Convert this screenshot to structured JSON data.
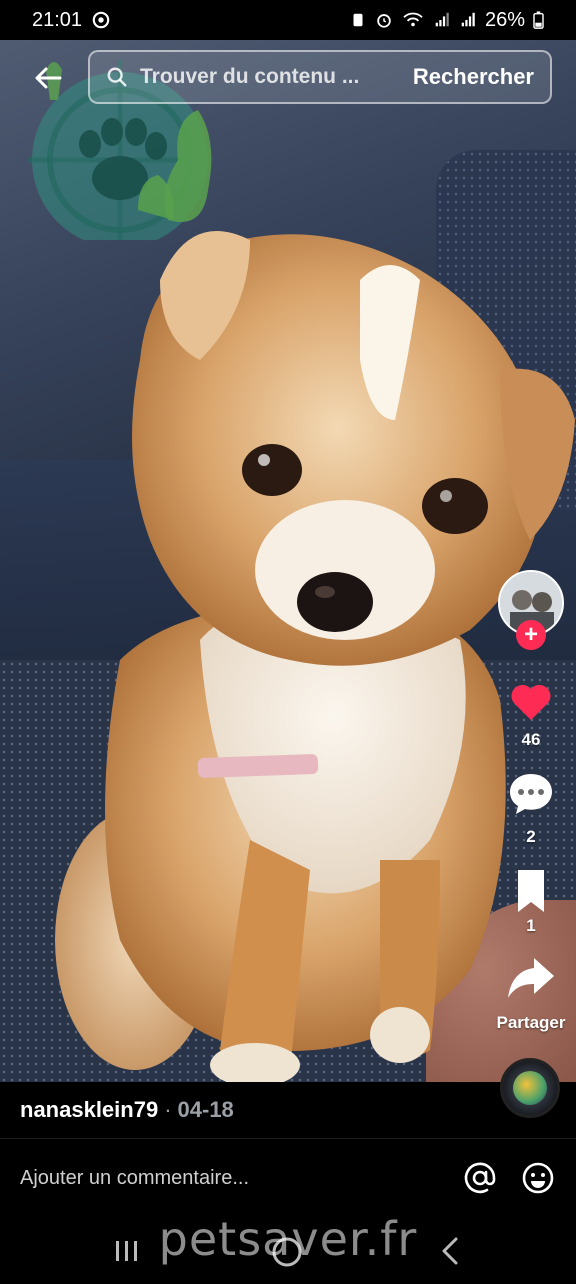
{
  "status_bar": {
    "time": "21:01",
    "battery": "26%"
  },
  "search": {
    "placeholder": "Trouver du contenu ...",
    "button_label": "Rechercher"
  },
  "actions": {
    "likes": "46",
    "comments": "2",
    "saves": "1",
    "share_label": "Partager"
  },
  "post": {
    "author": "nanasklein79",
    "separator": "·",
    "date": "04-18"
  },
  "comment_box": {
    "placeholder": "Ajouter un commentaire..."
  },
  "watermark": {
    "site": "petsaver.fr"
  },
  "colors": {
    "like": "#fe2c55",
    "follow": "#fe2c55",
    "logo": "#2f9a86"
  },
  "icons": [
    "back-arrow-icon",
    "search-icon",
    "heart-icon",
    "comment-icon",
    "bookmark-icon",
    "share-icon",
    "at-icon",
    "emoji-icon",
    "recent-apps-icon",
    "home-icon",
    "back-nav-icon"
  ]
}
